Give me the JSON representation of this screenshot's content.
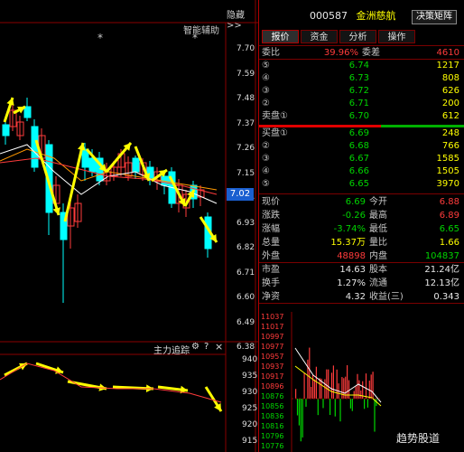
{
  "header": {
    "hide_label": "隐藏>>",
    "smart_assist": "智能辅助",
    "stock_code": "000587",
    "stock_name": "金洲慈航",
    "decision_button": "决策矩阵"
  },
  "tabs": [
    {
      "label": "报价",
      "active": true
    },
    {
      "label": "资金",
      "active": false
    },
    {
      "label": "分析",
      "active": false
    },
    {
      "label": "操作",
      "active": false
    }
  ],
  "ratio": {
    "label": "委比",
    "value": "39.96%",
    "diff_label": "委差",
    "diff_value": "4610"
  },
  "sell_orders": [
    {
      "level": "⑤",
      "price": "6.74",
      "volume": "1217"
    },
    {
      "level": "④",
      "price": "6.73",
      "volume": "808"
    },
    {
      "level": "③",
      "price": "6.72",
      "volume": "626"
    },
    {
      "level": "②",
      "price": "6.71",
      "volume": "200"
    },
    {
      "level": "卖盘①",
      "price": "6.70",
      "volume": "612"
    }
  ],
  "buy_orders": [
    {
      "level": "买盘①",
      "price": "6.69",
      "volume": "248"
    },
    {
      "level": "②",
      "price": "6.68",
      "volume": "766"
    },
    {
      "level": "③",
      "price": "6.67",
      "volume": "1585"
    },
    {
      "level": "④",
      "price": "6.66",
      "volume": "1505"
    },
    {
      "level": "⑤",
      "price": "6.65",
      "volume": "3970"
    }
  ],
  "quote": [
    {
      "l1": "现价",
      "v1": "6.69",
      "l2": "今开",
      "v2": "6.88",
      "c1": "green",
      "c2": "red"
    },
    {
      "l1": "涨跌",
      "v1": "-0.26",
      "l2": "最高",
      "v2": "6.89",
      "c1": "green",
      "c2": "red"
    },
    {
      "l1": "涨幅",
      "v1": "-3.74%",
      "l2": "最低",
      "v2": "6.65",
      "c1": "green",
      "c2": "green"
    },
    {
      "l1": "总量",
      "v1": "15.37万",
      "l2": "量比",
      "v2": "1.66",
      "c1": "yellow",
      "c2": "yellow"
    },
    {
      "l1": "外盘",
      "v1": "48898",
      "l2": "内盘",
      "v2": "104837",
      "c1": "red",
      "c2": "green"
    }
  ],
  "fundamentals": [
    {
      "l1": "市盈",
      "v1": "14.63",
      "l2": "股本",
      "v2": "21.24亿"
    },
    {
      "l1": "换手",
      "v1": "1.27%",
      "l2": "流通",
      "v2": "12.13亿"
    },
    {
      "l1": "净资",
      "v1": "4.32",
      "l2": "收益(三)",
      "v2": "0.343"
    }
  ],
  "price_axis": [
    "7.70",
    "7.59",
    "7.48",
    "7.37",
    "7.26",
    "7.15",
    "7.04",
    "6.93",
    "6.82",
    "6.71",
    "6.60",
    "6.49",
    "6.38"
  ],
  "current_price_tag": "7.02",
  "indicator": {
    "title": "主力追踪",
    "gear_icon": "⚙",
    "help_icon": "?",
    "close_icon": "×",
    "axis": [
      "940",
      "935",
      "930",
      "925",
      "920",
      "915"
    ]
  },
  "mini_chart_axis": [
    "11037",
    "11017",
    "10997",
    "10977",
    "10957",
    "10937",
    "10917",
    "10896",
    "10876",
    "10856",
    "10836",
    "10816",
    "10796",
    "10776"
  ],
  "watermark": "趋势股道",
  "markers": [
    "*",
    "*"
  ],
  "colors": {
    "up": "#ff3b3b",
    "down": "#00d400",
    "bg": "#000000",
    "border": "#b00000",
    "cyan_candle": "#00ffff",
    "arrow": "#ffff00"
  }
}
